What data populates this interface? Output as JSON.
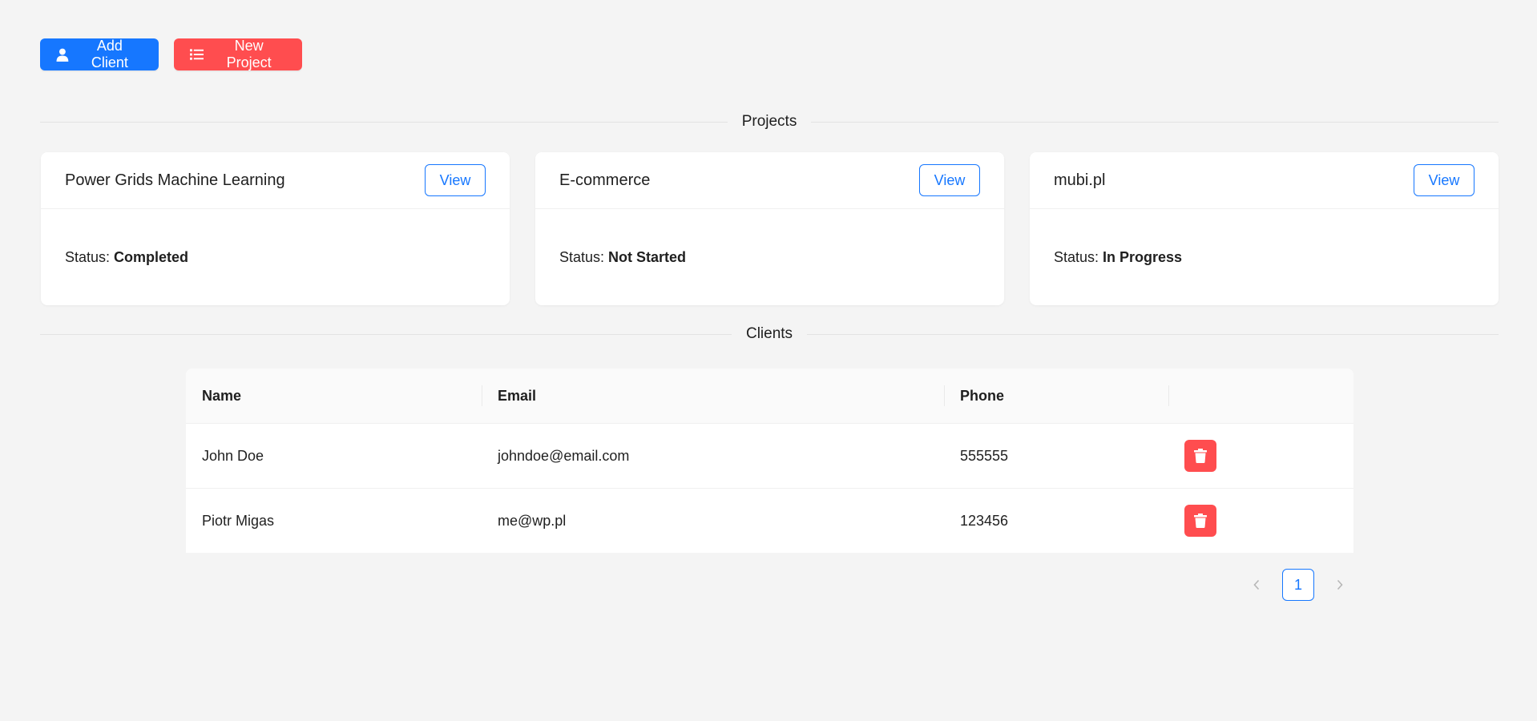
{
  "toolbar": {
    "add_client_label": "Add Client",
    "new_project_label": "New Project"
  },
  "projects_section": {
    "title": "Projects",
    "items": [
      {
        "name": "Power Grids Machine Learning",
        "view_label": "View",
        "status_label": "Status:",
        "status": "Completed"
      },
      {
        "name": "E-commerce",
        "view_label": "View",
        "status_label": "Status:",
        "status": "Not Started"
      },
      {
        "name": "mubi.pl",
        "view_label": "View",
        "status_label": "Status:",
        "status": "In Progress"
      }
    ]
  },
  "clients_section": {
    "title": "Clients",
    "columns": [
      "Name",
      "Email",
      "Phone",
      ""
    ],
    "rows": [
      {
        "name": "John Doe",
        "email": "johndoe@email.com",
        "phone": "555555"
      },
      {
        "name": "Piotr Migas",
        "email": "me@wp.pl",
        "phone": "123456"
      }
    ]
  },
  "pagination": {
    "current_page": "1",
    "prev_icon": "chevron-left-icon",
    "next_icon": "chevron-right-icon"
  },
  "colors": {
    "primary": "#1677ff",
    "danger": "#ff4d4f",
    "background": "#f4f4f4"
  }
}
